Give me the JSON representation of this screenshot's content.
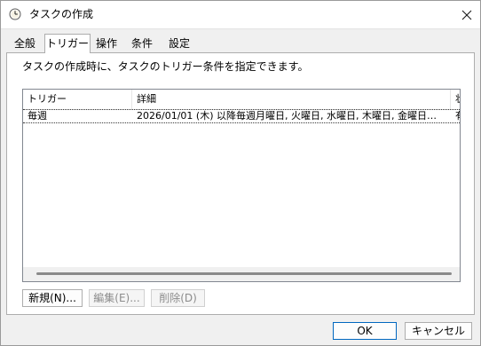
{
  "window": {
    "title": "タスクの作成",
    "close_icon": "close-icon",
    "app_icon": "clock-icon"
  },
  "tabs": [
    {
      "label": "全般",
      "active": false
    },
    {
      "label": "トリガー",
      "active": true
    },
    {
      "label": "操作",
      "active": false
    },
    {
      "label": "条件",
      "active": false
    },
    {
      "label": "設定",
      "active": false
    }
  ],
  "triggers_panel": {
    "description": "タスクの作成時に、タスクのトリガー条件を指定できます。",
    "columns": [
      "トリガー",
      "詳細",
      "状"
    ],
    "rows": [
      {
        "trigger": "毎週",
        "details": "2026/01/01 (木) 以降毎週月曜日, 火曜日, 水曜日, 木曜日, 金曜日…",
        "status": "有"
      }
    ],
    "buttons": {
      "new": "新規(N)...",
      "edit": "編集(E)...",
      "delete": "削除(D)"
    }
  },
  "footer": {
    "ok": "OK",
    "cancel": "キャンセル"
  },
  "colors": {
    "accent": "#0067c0",
    "window_bg": "#f0f0f0"
  }
}
